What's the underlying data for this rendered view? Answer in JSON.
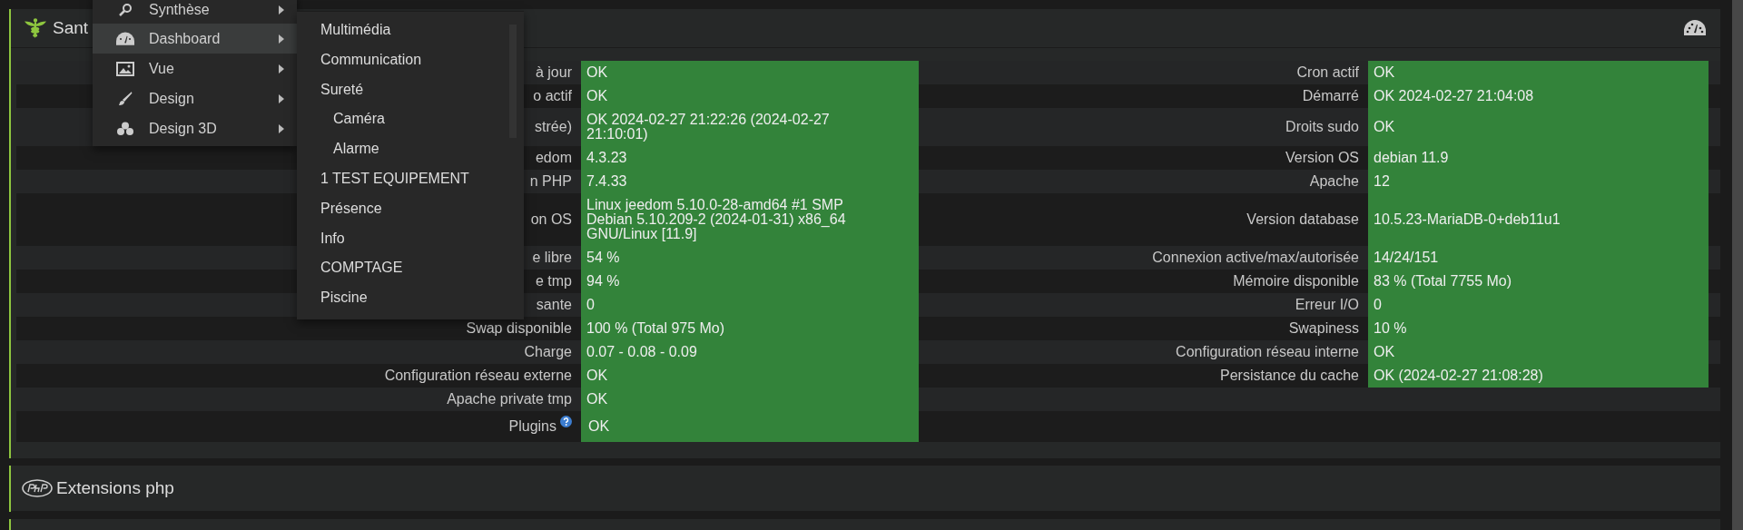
{
  "health_panel": {
    "title": "Sant"
  },
  "health_table": [
    {
      "left": {
        "label": "à jour",
        "value": "OK"
      },
      "right": {
        "label": "Cron actif",
        "value": "OK"
      }
    },
    {
      "left": {
        "label": "o actif",
        "value": "OK"
      },
      "right": {
        "label": "Démarré",
        "value": "OK 2024-02-27 21:04:08"
      }
    },
    {
      "left": {
        "label": "strée)",
        "value": "OK 2024-02-27 21:22:26 (2024-02-27 21:10:01)"
      },
      "right": {
        "label": "Droits sudo",
        "value": "OK"
      }
    },
    {
      "left": {
        "label": "edom",
        "value": "4.3.23"
      },
      "right": {
        "label": "Version OS",
        "value": "debian 11.9"
      }
    },
    {
      "left": {
        "label": "n PHP",
        "value": "7.4.33"
      },
      "right": {
        "label": "Apache",
        "value": "12"
      }
    },
    {
      "left": {
        "label": "on OS",
        "value": "Linux jeedom 5.10.0-28-amd64 #1 SMP Debian 5.10.209-2 (2024-01-31) x86_64 GNU/Linux [11.9]"
      },
      "right": {
        "label": "Version database",
        "value": "10.5.23-MariaDB-0+deb11u1"
      }
    },
    {
      "left": {
        "label": "e libre",
        "value": "54 %"
      },
      "right": {
        "label": "Connexion active/max/autorisée",
        "value": "14/24/151"
      }
    },
    {
      "left": {
        "label": "e tmp",
        "value": "94 %"
      },
      "right": {
        "label": "Mémoire disponible",
        "value": "83 % (Total 7755 Mo)"
      }
    },
    {
      "left": {
        "label": "sante",
        "value": "0"
      },
      "right": {
        "label": "Erreur I/O",
        "value": "0"
      }
    },
    {
      "left": {
        "label": "Swap disponible",
        "value": "100 % (Total 975 Mo)"
      },
      "right": {
        "label": "Swapiness",
        "value": "10 %"
      }
    },
    {
      "left": {
        "label": "Charge",
        "value": "0.07 - 0.08 - 0.09"
      },
      "right": {
        "label": "Configuration réseau interne",
        "value": "OK"
      }
    },
    {
      "left": {
        "label": "Configuration réseau externe",
        "value": "OK"
      },
      "right": {
        "label": "Persistance du cache",
        "value": "OK (2024-02-27 21:08:28)"
      }
    },
    {
      "left": {
        "label": "Apache private tmp",
        "value": "OK"
      }
    },
    {
      "left": {
        "label": "Plugins",
        "value": "OK",
        "help": true
      }
    }
  ],
  "extensions_panel": {
    "title": "Extensions php"
  },
  "menu": {
    "items": [
      {
        "label": "Synthèse",
        "selected": false
      },
      {
        "label": "Dashboard",
        "selected": true
      },
      {
        "label": "Vue",
        "selected": false
      },
      {
        "label": "Design",
        "selected": false
      },
      {
        "label": "Design 3D",
        "selected": false
      }
    ]
  },
  "submenu": {
    "items": [
      {
        "label": "Multimédia"
      },
      {
        "label": "Communication"
      },
      {
        "label": "Sureté",
        "children": [
          {
            "label": "Caméra"
          },
          {
            "label": "Alarme"
          }
        ]
      },
      {
        "label": "1 TEST EQUIPEMENT"
      },
      {
        "label": "Présence"
      },
      {
        "label": "Info"
      },
      {
        "label": "COMPTAGE"
      },
      {
        "label": "Piscine"
      }
    ]
  }
}
